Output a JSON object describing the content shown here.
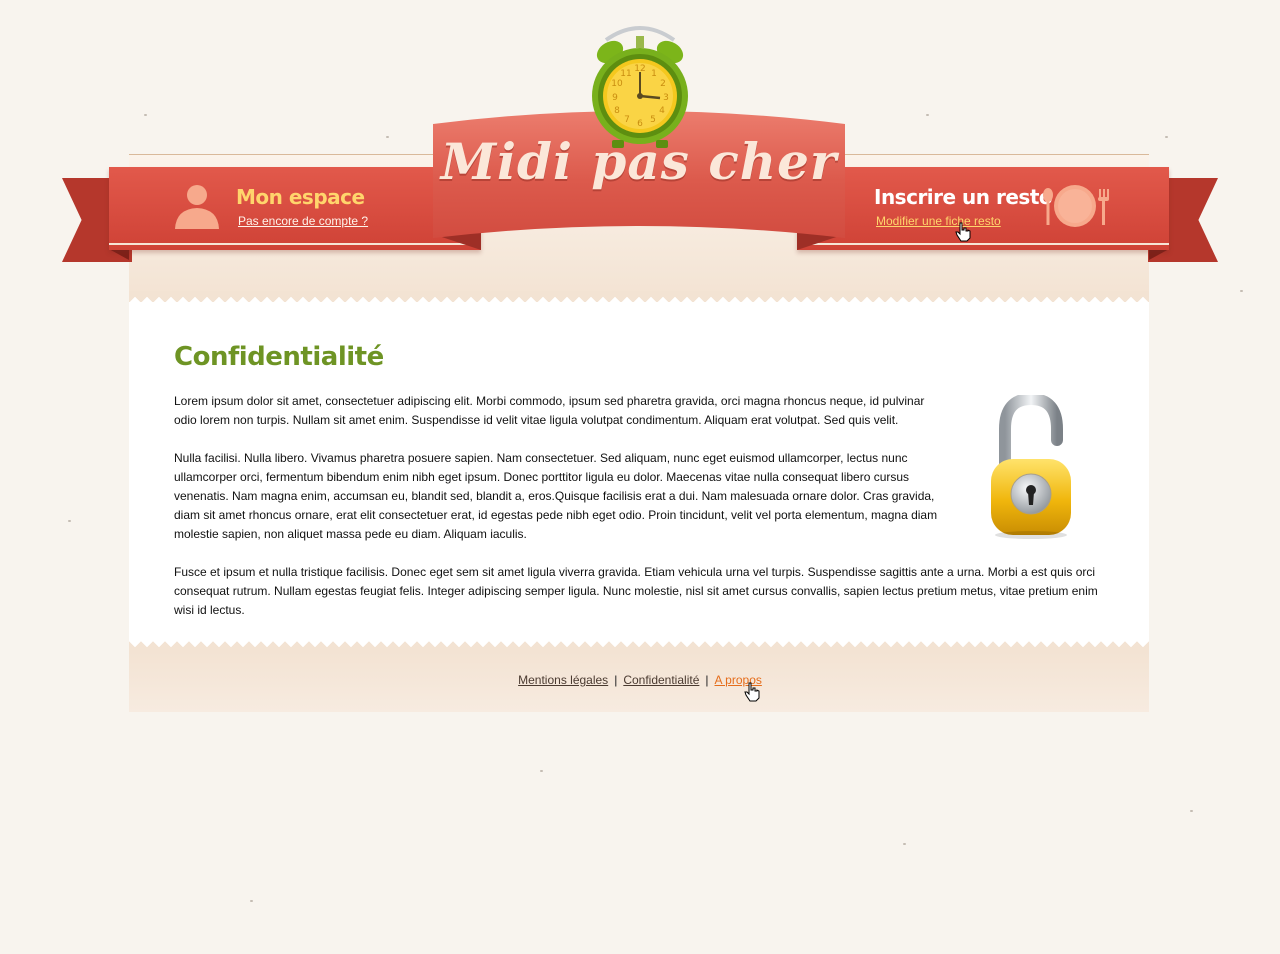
{
  "site": {
    "logo_text": "Midi pas cher"
  },
  "header": {
    "left": {
      "title": "Mon espace",
      "link": "Pas encore de compte ?",
      "icon": "user-icon"
    },
    "right": {
      "title": "Inscrire un resto",
      "link": "Modifier une fiche resto",
      "icon": "plate-cutlery-icon"
    }
  },
  "main": {
    "title": "Confidentialité",
    "paragraphs": [
      "Lorem ipsum dolor sit amet, consectetuer adipiscing elit. Morbi commodo, ipsum sed pharetra gravida, orci magna rhoncus neque, id pulvinar odio lorem non turpis. Nullam sit amet enim. Suspendisse id velit vitae ligula volutpat condimentum. Aliquam erat volutpat. Sed quis velit.",
      "Nulla facilisi. Nulla libero. Vivamus pharetra posuere sapien. Nam consectetuer. Sed aliquam, nunc eget euismod ullamcorper, lectus nunc ullamcorper orci, fermentum bibendum enim nibh eget ipsum. Donec porttitor ligula eu dolor. Maecenas vitae nulla consequat libero cursus venenatis. Nam magna enim, accumsan eu, blandit sed, blandit a, eros.Quisque facilisis erat a dui. Nam malesuada ornare dolor. Cras gravida, diam sit amet rhoncus ornare, erat elit consectetuer erat, id egestas pede nibh eget odio. Proin tincidunt, velit vel porta elementum, magna diam  molestie sapien, non aliquet massa pede eu diam. Aliquam iaculis.",
      "Fusce et ipsum et nulla tristique facilisis. Donec eget sem sit amet ligula viverra gravida. Etiam vehicula urna vel turpis. Suspendisse sagittis ante a urna. Morbi a est quis orci consequat rutrum. Nullam egestas feugiat felis. Integer adipiscing semper ligula. Nunc molestie, nisl sit amet cursus convallis, sapien lectus pretium metus, vitae pretium enim wisi id lectus."
    ],
    "illustration_icon": "padlock-icon"
  },
  "footer": {
    "links": [
      "Mentions légales",
      "Confidentialité",
      "A propos"
    ],
    "separator": "|"
  },
  "colors": {
    "ribbon_red": "#d24c40",
    "title_green": "#6e9424",
    "accent_yellow": "#ffd56c",
    "link_orange": "#e56d1b"
  }
}
